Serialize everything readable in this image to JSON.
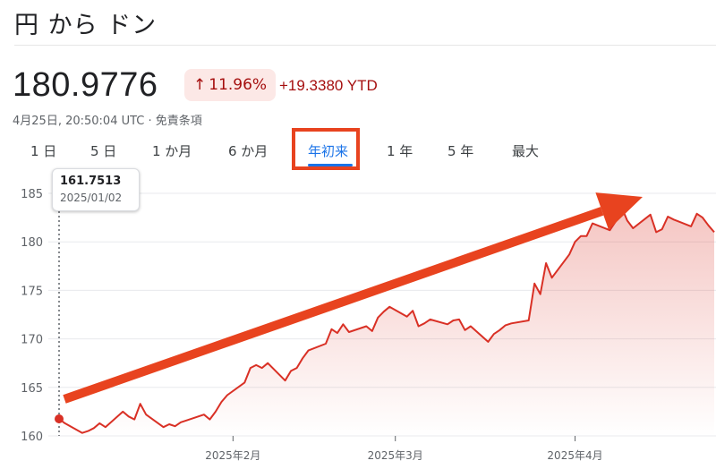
{
  "header": {
    "title": "円 から ドン"
  },
  "quote": {
    "price": "180.9776",
    "change_arrow": "↑",
    "change_percent": "11.96%",
    "change_amount": "+19.3380 YTD",
    "timestamp": "4月25日, 20:50:04 UTC",
    "separator": "·",
    "disclaimer": "免責条項"
  },
  "tabs": [
    {
      "label": "1 日",
      "active": false
    },
    {
      "label": "5 日",
      "active": false
    },
    {
      "label": "1 か月",
      "active": false
    },
    {
      "label": "6 か月",
      "active": false
    },
    {
      "label": "年初来",
      "active": true
    },
    {
      "label": "1 年",
      "active": false
    },
    {
      "label": "5 年",
      "active": false
    },
    {
      "label": "最大",
      "active": false
    }
  ],
  "tooltip": {
    "value": "161.7513",
    "date": "2025/01/02"
  },
  "colors": {
    "line": "#d93025",
    "fill": "#d93025",
    "annotation": "#e8431f",
    "negative_text": "#a50e0e",
    "badge_bg": "#fce8e6",
    "active_tab": "#1a73e8"
  },
  "chart_data": {
    "type": "area",
    "ylim": [
      160,
      185
    ],
    "yticks": [
      160,
      165,
      170,
      175,
      180,
      185
    ],
    "xticks": [
      "2025年2月",
      "2025年3月",
      "2025年4月"
    ],
    "x": [
      "2025/01/02",
      "2025/01/03",
      "2025/01/06",
      "2025/01/07",
      "2025/01/08",
      "2025/01/09",
      "2025/01/10",
      "2025/01/13",
      "2025/01/14",
      "2025/01/15",
      "2025/01/16",
      "2025/01/17",
      "2025/01/20",
      "2025/01/21",
      "2025/01/22",
      "2025/01/23",
      "2025/01/24",
      "2025/01/27",
      "2025/01/28",
      "2025/01/29",
      "2025/01/30",
      "2025/01/31",
      "2025/02/03",
      "2025/02/04",
      "2025/02/05",
      "2025/02/06",
      "2025/02/07",
      "2025/02/10",
      "2025/02/11",
      "2025/02/12",
      "2025/02/13",
      "2025/02/14",
      "2025/02/17",
      "2025/02/18",
      "2025/02/19",
      "2025/02/20",
      "2025/02/21",
      "2025/02/24",
      "2025/02/25",
      "2025/02/26",
      "2025/02/27",
      "2025/02/28",
      "2025/03/03",
      "2025/03/04",
      "2025/03/05",
      "2025/03/06",
      "2025/03/07",
      "2025/03/10",
      "2025/03/11",
      "2025/03/12",
      "2025/03/13",
      "2025/03/14",
      "2025/03/17",
      "2025/03/18",
      "2025/03/19",
      "2025/03/20",
      "2025/03/21",
      "2025/03/24",
      "2025/03/25",
      "2025/03/26",
      "2025/03/27",
      "2025/03/28",
      "2025/03/31",
      "2025/04/01",
      "2025/04/02",
      "2025/04/03",
      "2025/04/04",
      "2025/04/07",
      "2025/04/08",
      "2025/04/09",
      "2025/04/10",
      "2025/04/11",
      "2025/04/14",
      "2025/04/15",
      "2025/04/16",
      "2025/04/17",
      "2025/04/18",
      "2025/04/21",
      "2025/04/22",
      "2025/04/23",
      "2025/04/24",
      "2025/04/25"
    ],
    "values": [
      161.75,
      161.3,
      160.3,
      160.5,
      160.8,
      161.3,
      160.9,
      162.5,
      162.0,
      161.7,
      163.3,
      162.2,
      160.9,
      161.2,
      161.0,
      161.4,
      161.6,
      162.2,
      161.7,
      162.5,
      163.5,
      164.2,
      165.5,
      167.0,
      167.3,
      167.0,
      167.5,
      165.7,
      166.7,
      167.0,
      168.0,
      168.8,
      169.5,
      171.0,
      170.6,
      171.5,
      170.7,
      171.3,
      170.8,
      172.2,
      172.8,
      173.3,
      172.3,
      172.9,
      171.3,
      171.6,
      172.0,
      171.5,
      171.9,
      172.0,
      170.9,
      171.3,
      169.7,
      170.5,
      170.9,
      171.4,
      171.6,
      171.9,
      175.7,
      174.6,
      177.8,
      176.3,
      178.7,
      180.0,
      180.6,
      180.6,
      181.9,
      181.2,
      182.1,
      183.6,
      182.2,
      181.4,
      182.8,
      181.0,
      181.3,
      182.6,
      182.3,
      181.6,
      182.9,
      182.5,
      181.7,
      181.0
    ],
    "highlighted_point": {
      "x": "2025/01/02",
      "y": 161.7513
    }
  }
}
